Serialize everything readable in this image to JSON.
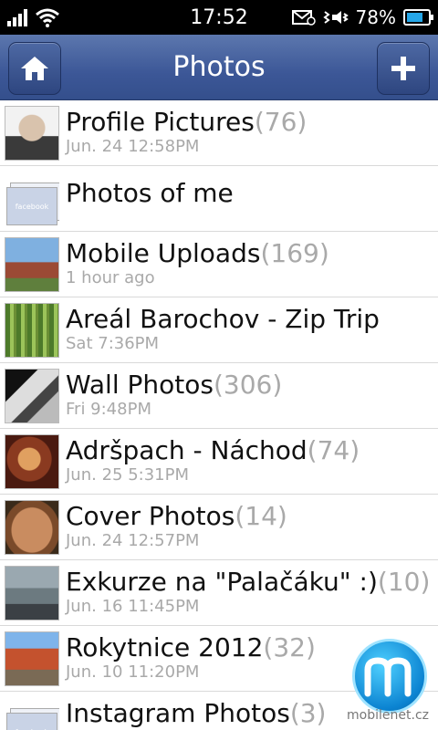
{
  "status": {
    "time": "17:52",
    "battery": "78%",
    "battery_fraction": 0.78
  },
  "header": {
    "title": "Photos",
    "home_icon": "home-icon",
    "add_icon": "plus-icon"
  },
  "albums": [
    {
      "title": "Profile Pictures",
      "count": "(76)",
      "subtitle": "Jun. 24 12:58PM"
    },
    {
      "title": "Photos of me",
      "count": "",
      "subtitle": ""
    },
    {
      "title": "Mobile Uploads",
      "count": "(169)",
      "subtitle": "1 hour ago"
    },
    {
      "title": "Areál Barochov - Zip Trip",
      "count": "",
      "subtitle": "Sat 7:36PM"
    },
    {
      "title": "Wall Photos",
      "count": "(306)",
      "subtitle": "Fri 9:48PM"
    },
    {
      "title": "Adršpach - Náchod",
      "count": "(74)",
      "subtitle": "Jun. 25 5:31PM"
    },
    {
      "title": "Cover Photos",
      "count": "(14)",
      "subtitle": "Jun. 24 12:57PM"
    },
    {
      "title": "Exkurze na \"Palačáku\" :)",
      "count": "(10)",
      "subtitle": "Jun. 16 11:45PM"
    },
    {
      "title": "Rokytnice 2012",
      "count": "(32)",
      "subtitle": "Jun. 10 11:20PM"
    },
    {
      "title": "Instagram Photos",
      "count": "(3)",
      "subtitle": ""
    }
  ],
  "placeholder_label": "facebook",
  "watermark": {
    "text": "mobilenet.cz",
    "logo_letter": "m"
  }
}
